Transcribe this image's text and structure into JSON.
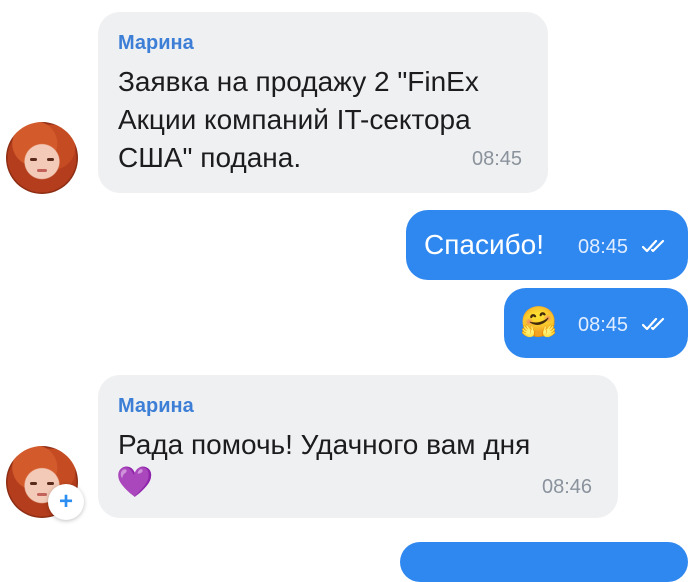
{
  "messages": [
    {
      "type": "incoming",
      "sender": "Марина",
      "text_lines": [
        "Заявка на продажу 2 \"FinEx",
        "Акции компаний IT-сектора",
        "США\" подана."
      ],
      "time": "08:45"
    },
    {
      "type": "outgoing",
      "text": "Спасибо!",
      "time": "08:45",
      "status_icon": "double-check-icon"
    },
    {
      "type": "outgoing",
      "emoji": "🤗",
      "time": "08:45",
      "status_icon": "double-check-icon"
    },
    {
      "type": "incoming",
      "sender": "Марина",
      "text": "Рада помочь! Удачного вам дня",
      "emoji": "💜",
      "time": "08:46"
    }
  ],
  "avatar_badge": "+",
  "colors": {
    "incoming_bubble": "#eff0f2",
    "outgoing_bubble": "#2f88ef",
    "sender_name": "#3d7fd6",
    "time_incoming": "#8a929c"
  }
}
